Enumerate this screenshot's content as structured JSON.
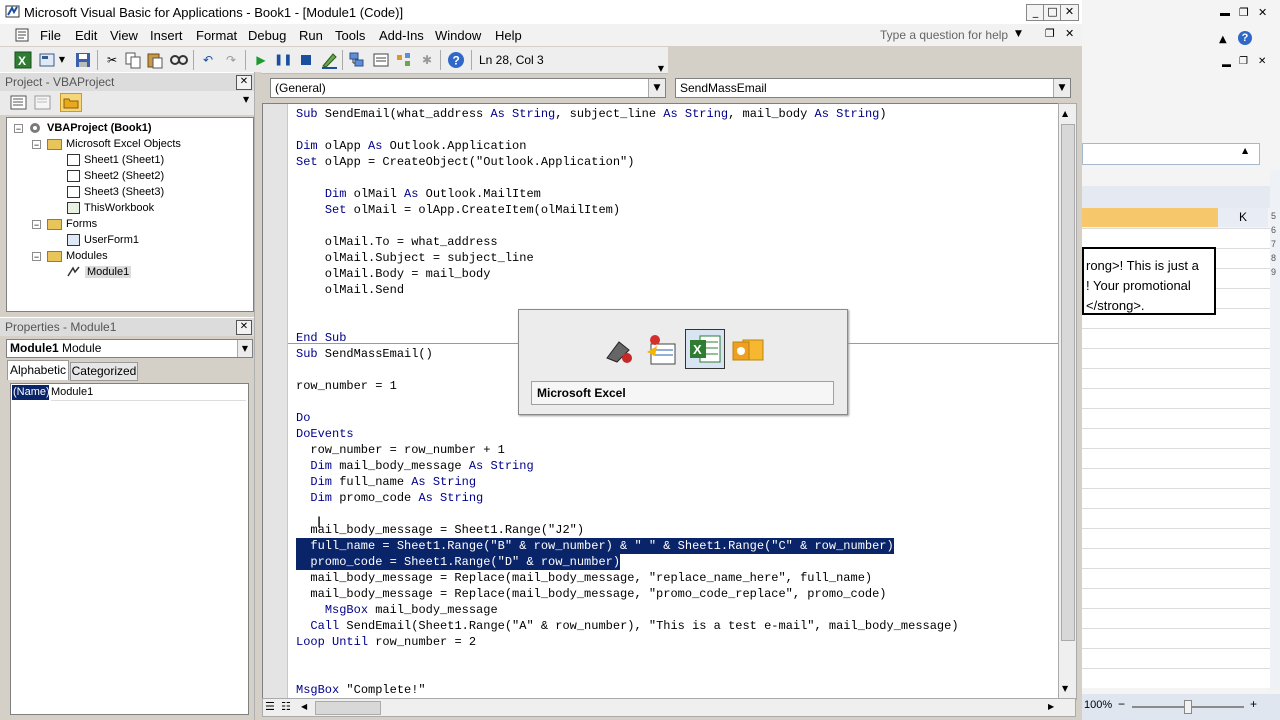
{
  "window": {
    "title": "Microsoft Visual Basic for Applications - Book1 - [Module1 (Code)]"
  },
  "menu": {
    "items": [
      "File",
      "Edit",
      "View",
      "Insert",
      "Format",
      "Debug",
      "Run",
      "Tools",
      "Add-Ins",
      "Window",
      "Help"
    ],
    "help_box_placeholder": "Type a question for help"
  },
  "toolbar": {
    "position": "Ln 28, Col 3"
  },
  "project_pane": {
    "title": "Project - VBAProject",
    "nodes": {
      "root": "VBAProject (Book1)",
      "excel_objects": "Microsoft Excel Objects",
      "sheet1": "Sheet1 (Sheet1)",
      "sheet2": "Sheet2 (Sheet2)",
      "sheet3": "Sheet3 (Sheet3)",
      "thisworkbook": "ThisWorkbook",
      "forms": "Forms",
      "userform1": "UserForm1",
      "modules": "Modules",
      "module1": "Module1"
    }
  },
  "properties_pane": {
    "title": "Properties - Module1",
    "object_name": "Module1",
    "object_type": "Module",
    "tab_alphabetic": "Alphabetic",
    "tab_categorized": "Categorized",
    "prop_name": "(Name)",
    "prop_value": "Module1"
  },
  "code_window": {
    "object_combo": "(General)",
    "procedure_combo": "SendMassEmail",
    "lines": [
      "Sub SendEmail(what_address As String, subject_line As String, mail_body As String)",
      "",
      "Dim olApp As Outlook.Application",
      "Set olApp = CreateObject(\"Outlook.Application\")",
      "",
      "    Dim olMail As Outlook.MailItem",
      "    Set olMail = olApp.CreateItem(olMailItem)",
      "",
      "    olMail.To = what_address",
      "    olMail.Subject = subject_line",
      "    olMail.Body = mail_body",
      "    olMail.Send",
      "",
      "",
      "End Sub",
      "Sub SendMassEmail()",
      "",
      "row_number = 1",
      "",
      "Do",
      "DoEvents",
      "  row_number = row_number + 1",
      "  Dim mail_body_message As String",
      "  Dim full_name As String",
      "  Dim promo_code As String",
      "",
      "  mail_body_message = Sheet1.Range(\"J2\")",
      "  full_name = Sheet1.Range(\"B\" & row_number) & \" \" & Sheet1.Range(\"C\" & row_number)",
      "  promo_code = Sheet1.Range(\"D\" & row_number)",
      "  mail_body_message = Replace(mail_body_message, \"replace_name_here\", full_name)",
      "  mail_body_message = Replace(mail_body_message, \"promo_code_replace\", promo_code)",
      "    MsgBox mail_body_message",
      "  Call SendEmail(Sheet1.Range(\"A\" & row_number), \"This is a test e-mail\", mail_body_message)",
      "Loop Until row_number = 2",
      "",
      "",
      "MsgBox \"Complete!\""
    ],
    "selected_lines": [
      27,
      28
    ]
  },
  "app_switcher": {
    "selected_label": "Microsoft Excel",
    "apps": [
      "vba-app-icon",
      "form-app-icon",
      "excel-app-icon",
      "outlook-app-icon"
    ]
  },
  "excel_background": {
    "column_label": "K",
    "cell_text_1": "rong>! This is just a",
    "cell_text_2": "! Your promotional",
    "cell_text_3": "</strong>.",
    "zoom": "100%",
    "row_numbers": [
      "5",
      "6",
      "7",
      "8",
      "9"
    ]
  },
  "colors": {
    "keyword": "#00008b",
    "selection": "#0a246a",
    "excel_header_accent": "#f7c86b"
  }
}
